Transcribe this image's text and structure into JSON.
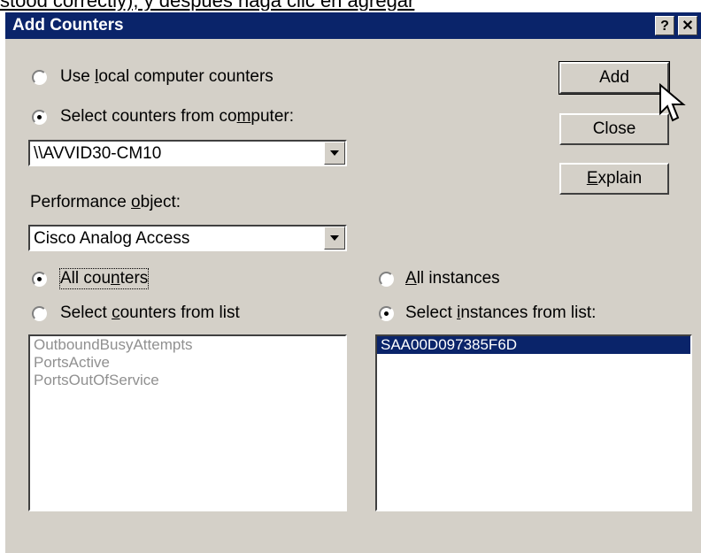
{
  "background": {
    "text": "stood correctly), y despues haga clic en agregar"
  },
  "window": {
    "title": "Add Counters",
    "help_btn": "?",
    "close_btn": "✕"
  },
  "radios": {
    "local_prefix": "Use ",
    "local_key": "l",
    "local_suffix": "ocal computer counters",
    "remote_prefix": "Select counters from co",
    "remote_key": "m",
    "remote_suffix": "puter:"
  },
  "computer_combo": {
    "value": "\\\\AVVID30-CM10"
  },
  "perf": {
    "label_prefix": "Performance ",
    "label_key": "o",
    "label_suffix": "bject:",
    "value": "Cisco Analog Access"
  },
  "counters": {
    "all_prefix": "All cou",
    "all_key": "n",
    "all_suffix": "ters",
    "select_prefix": "Select ",
    "select_key": "c",
    "select_suffix": "ounters from list",
    "items": [
      "OutboundBusyAttempts",
      "PortsActive",
      "PortsOutOfService"
    ]
  },
  "instances": {
    "all_key": "A",
    "all_suffix": "ll instances",
    "select_prefix": "Select ",
    "select_key": "i",
    "select_suffix": "nstances from list:",
    "items": [
      "SAA00D097385F6D"
    ]
  },
  "buttons": {
    "add": "Add",
    "close": "Close",
    "explain_key": "E",
    "explain_suffix": "xplain"
  }
}
